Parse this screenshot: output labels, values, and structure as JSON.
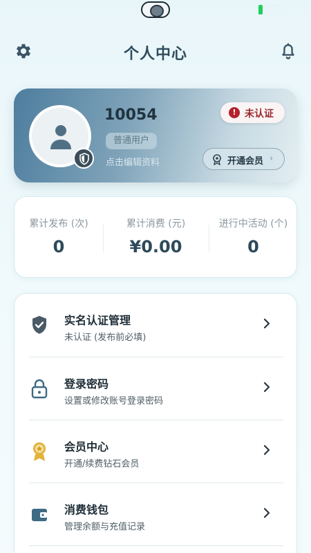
{
  "status_bar": {
    "time": "",
    "network": ""
  },
  "header": {
    "title": "个人中心"
  },
  "profile": {
    "user_id": "10054",
    "user_type": "普通用户",
    "edit_link": "点击编辑资料",
    "verify_status": "未认证",
    "vip_button_label": "开通会员",
    "vip_button_chevron": "›"
  },
  "stats": [
    {
      "label": "累计发布 (次)",
      "value": "0"
    },
    {
      "label": "累计消费 (元)",
      "value": "¥0.00"
    },
    {
      "label": "进行中活动 (个)",
      "value": "0"
    }
  ],
  "menu": [
    {
      "title": "实名认证管理",
      "subtitle": "未认证 (发布前必填)",
      "icon": "shield-check-icon"
    },
    {
      "title": "登录密码",
      "subtitle": "设置或修改账号登录密码",
      "icon": "lock-icon"
    },
    {
      "title": "会员中心",
      "subtitle": "开通/续费钻石会员",
      "icon": "medal-icon"
    },
    {
      "title": "消费钱包",
      "subtitle": "管理余额与充值记录",
      "icon": "wallet-icon"
    }
  ],
  "colors": {
    "accent": "#4d7d9e",
    "alert": "#b4232c",
    "gold": "#e2b23a",
    "text_primary": "#1f2e38"
  }
}
